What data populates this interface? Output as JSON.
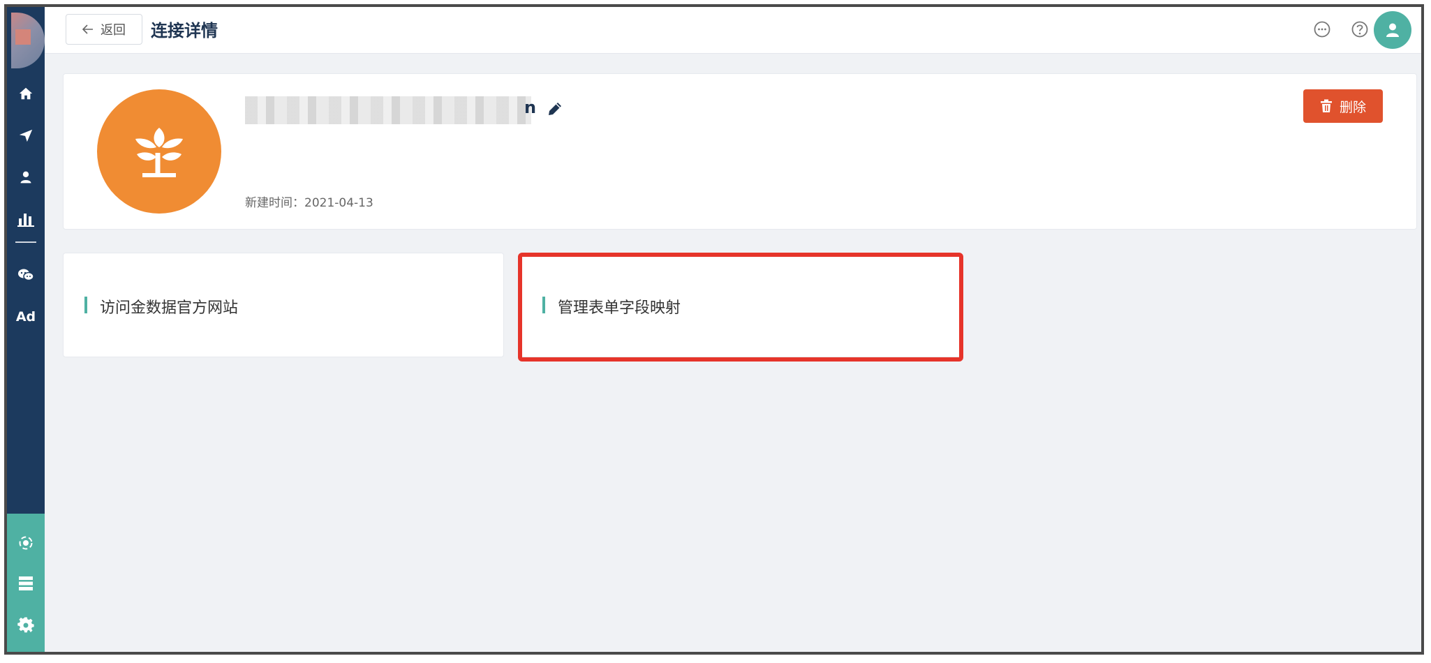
{
  "header": {
    "back_label": "返回",
    "title": "连接详情"
  },
  "sidebar": {
    "items": [
      {
        "icon": "home-icon"
      },
      {
        "icon": "send-icon"
      },
      {
        "icon": "user-icon"
      },
      {
        "icon": "bar-chart-icon"
      },
      {
        "icon": "wechat-icon"
      },
      {
        "label": "Ad"
      }
    ],
    "bottom_items": [
      {
        "icon": "connection-icon"
      },
      {
        "icon": "database-icon"
      },
      {
        "icon": "gear-icon"
      }
    ]
  },
  "connection": {
    "name_suffix": "n",
    "created_label": "新建时间：",
    "created_date": "2021-04-13",
    "delete_label": "删除"
  },
  "cards": [
    {
      "label": "访问金数据官方网站"
    },
    {
      "label": "管理表单字段映射"
    }
  ],
  "colors": {
    "sidebar": "#1c3a5e",
    "accent": "#4fb1a3",
    "logo": "#f08c33",
    "danger": "#e0522d",
    "highlight": "#e6342a"
  }
}
